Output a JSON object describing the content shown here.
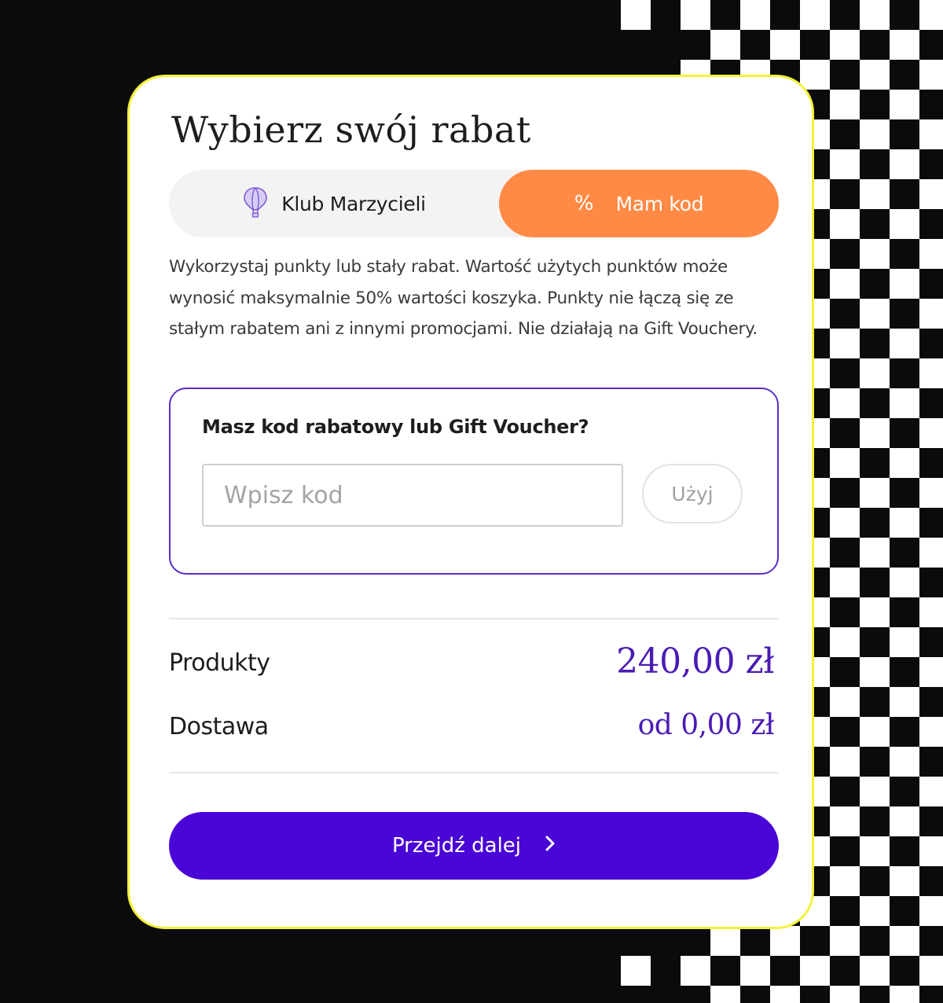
{
  "colors": {
    "background": "#0b0b0c",
    "card_border": "#f2f23a",
    "tab_active": "#ff8a45",
    "accent_purple": "#4a06d6",
    "price_color": "#4a1bb5",
    "code_box_border": "#5a2ec8"
  },
  "card": {
    "title": "Wybierz swój rabat",
    "tabs": [
      {
        "label": "Klub Marzycieli",
        "icon": "hot-air-balloon-icon",
        "active": false
      },
      {
        "label": "Mam kod",
        "icon": "percent-icon",
        "active": true
      }
    ],
    "description": "Wykorzystaj punkty lub stały rabat. Wartość użytych punktów może wynosić maksymalnie 50% wartości koszyka. Punkty nie łączą się ze stałym rabatem ani z innymi promocjami. Nie działają na Gift Vouchery.",
    "code_section": {
      "title": "Masz kod rabatowy lub Gift Voucher?",
      "input_placeholder": "Wpisz kod",
      "apply_label": "Użyj"
    },
    "summary": {
      "products_label": "Produkty",
      "products_value": "240,00 zł",
      "delivery_label": "Dostawa",
      "delivery_value": "od 0,00 zł"
    },
    "continue_label": "Przejdź dalej",
    "continue_icon": "chevron-right-icon"
  }
}
